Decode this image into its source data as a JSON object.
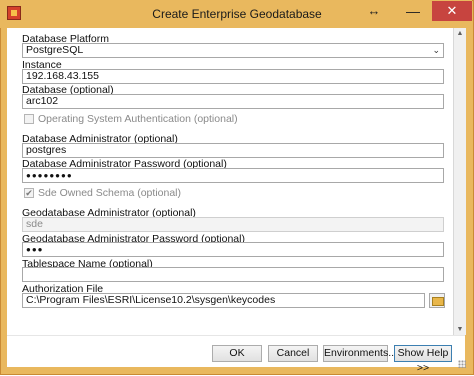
{
  "window": {
    "title": "Create Enterprise Geodatabase",
    "controls": {
      "resize": "↔",
      "minimize": "—",
      "close": "✕"
    }
  },
  "form": {
    "platform": {
      "label": "Database Platform",
      "value": "PostgreSQL"
    },
    "instance": {
      "label": "Instance",
      "value": "192.168.43.155"
    },
    "database": {
      "label": "Database (optional)",
      "value": "arc102"
    },
    "os_auth": {
      "label": "Operating System Authentication (optional)",
      "checked": false
    },
    "db_admin": {
      "label": "Database Administrator (optional)",
      "value": "postgres"
    },
    "db_admin_password": {
      "label": "Database Administrator Password (optional)",
      "value": "●●●●●●●●"
    },
    "sde_owned": {
      "label": "Sde Owned Schema (optional)",
      "checked": true,
      "mark": "✔"
    },
    "gdb_admin": {
      "label": "Geodatabase Administrator (optional)",
      "value": "sde"
    },
    "gdb_admin_password": {
      "label": "Geodatabase Administrator Password (optional)",
      "value": "●●●"
    },
    "tablespace": {
      "label": "Tablespace Name (optional)",
      "value": ""
    },
    "auth_file": {
      "label": "Authorization File",
      "value": "C:\\Program Files\\ESRI\\License10.2\\sysgen\\keycodes"
    }
  },
  "buttons": {
    "ok": "OK",
    "cancel": "Cancel",
    "environments": "Environments...",
    "show_help": "Show Help >>"
  },
  "colors": {
    "titlebar": "#e9b85e",
    "close": "#c7443f",
    "primary_border": "#3c7fb1"
  }
}
